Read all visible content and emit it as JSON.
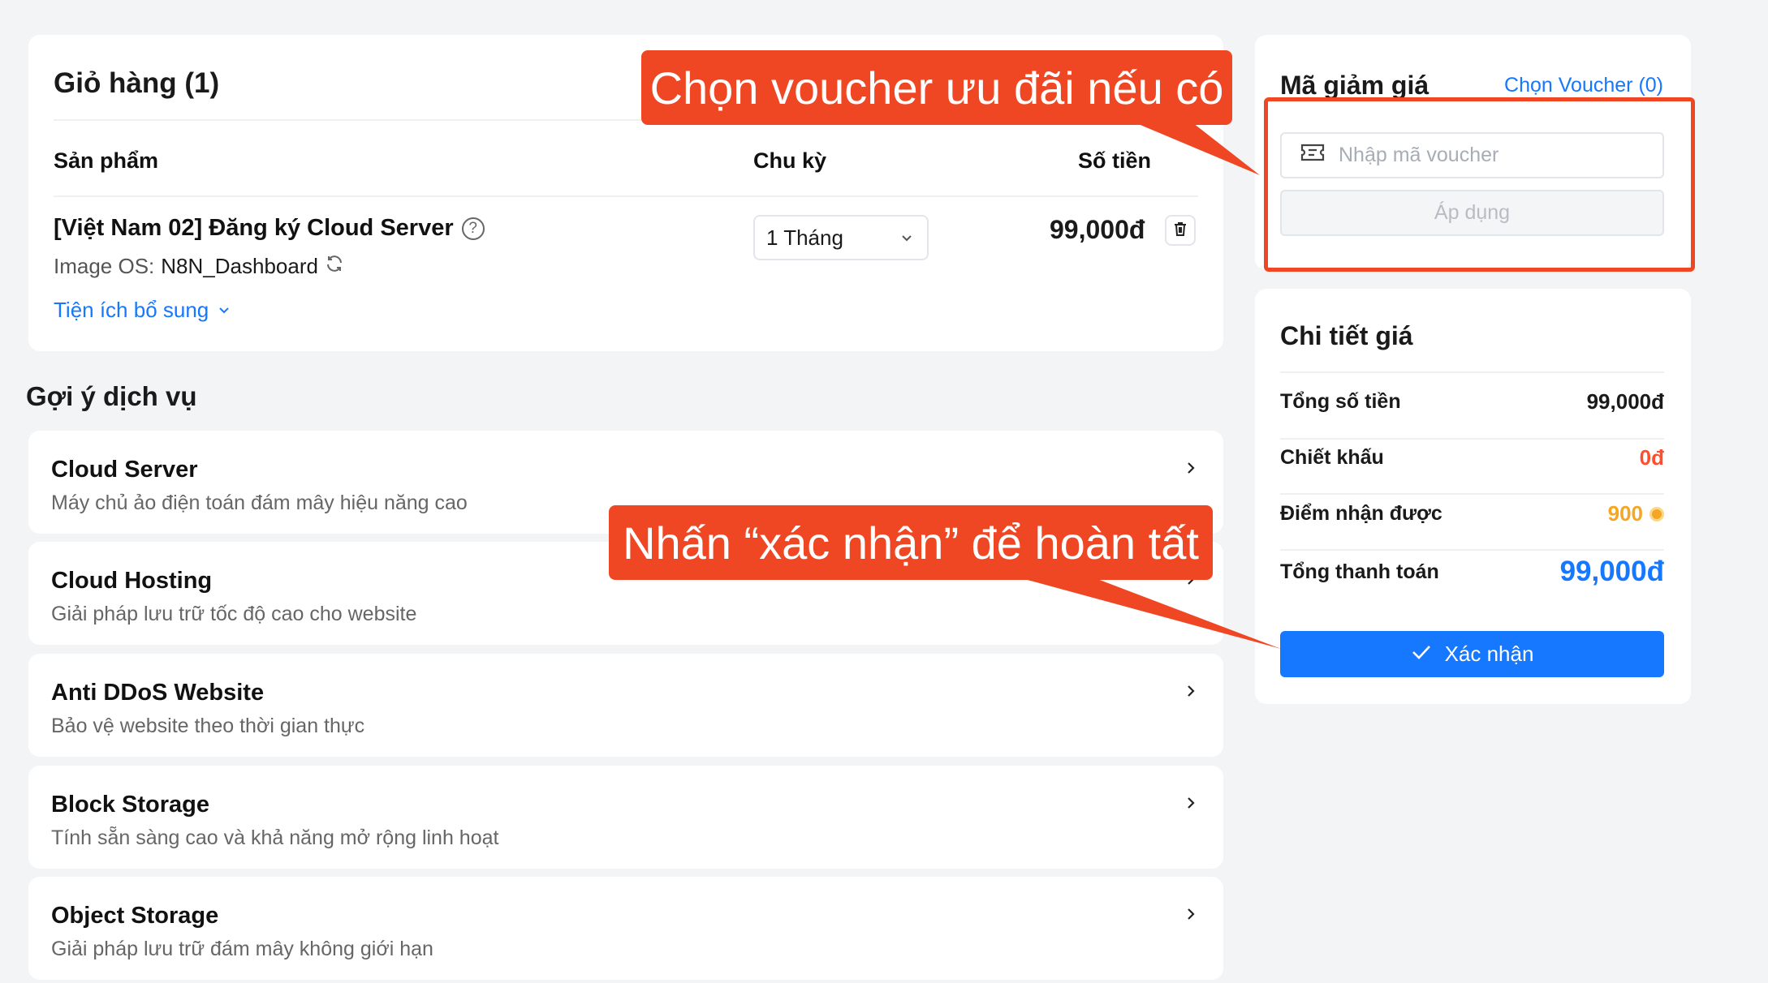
{
  "cart": {
    "title": "Giỏ hàng (1)",
    "col_product": "Sản phẩm",
    "col_cycle": "Chu kỳ",
    "col_amount": "Số tiền",
    "item": {
      "name": "[Việt Nam 02] Đăng ký Cloud Server",
      "image_os_label": "Image OS:",
      "image_os_value": "N8N_Dashboard",
      "addons_label": "Tiện ích bổ sung",
      "cycle": "1 Tháng",
      "price": "99,000đ"
    }
  },
  "suggestions": {
    "title": "Gợi ý dịch vụ",
    "items": [
      {
        "name": "Cloud Server",
        "desc": "Máy chủ ảo điện toán đám mây hiệu năng cao"
      },
      {
        "name": "Cloud Hosting",
        "desc": "Giải pháp lưu trữ tốc độ cao cho website"
      },
      {
        "name": "Anti DDoS Website",
        "desc": "Bảo vệ website theo thời gian thực"
      },
      {
        "name": "Block Storage",
        "desc": "Tính sẵn sàng cao và khả năng mở rộng linh hoạt"
      },
      {
        "name": "Object Storage",
        "desc": "Giải pháp lưu trữ đám mây không giới hạn"
      }
    ]
  },
  "voucher": {
    "title": "Mã giảm giá",
    "choose_link": "Chọn Voucher (0)",
    "input_placeholder": "Nhập mã voucher",
    "apply_label": "Áp dụng"
  },
  "pricing": {
    "title": "Chi tiết giá",
    "rows": [
      {
        "label": "Tổng số tiền",
        "value": "99,000đ"
      },
      {
        "label": "Chiết khấu",
        "value": "0đ"
      },
      {
        "label": "Điểm nhận được",
        "value": "900"
      },
      {
        "label": "Tổng thanh toán",
        "value": "99,000đ"
      }
    ],
    "confirm_label": "Xác nhận"
  },
  "annotations": {
    "voucher_hint": "Chọn voucher ưu đãi nếu có",
    "confirm_hint": "Nhấn “xác nhận” để hoàn tất"
  },
  "colors": {
    "accent": "#1677ff",
    "annotation": "#ef4723",
    "discount": "#ff4d2e",
    "points": "#f5a623"
  }
}
